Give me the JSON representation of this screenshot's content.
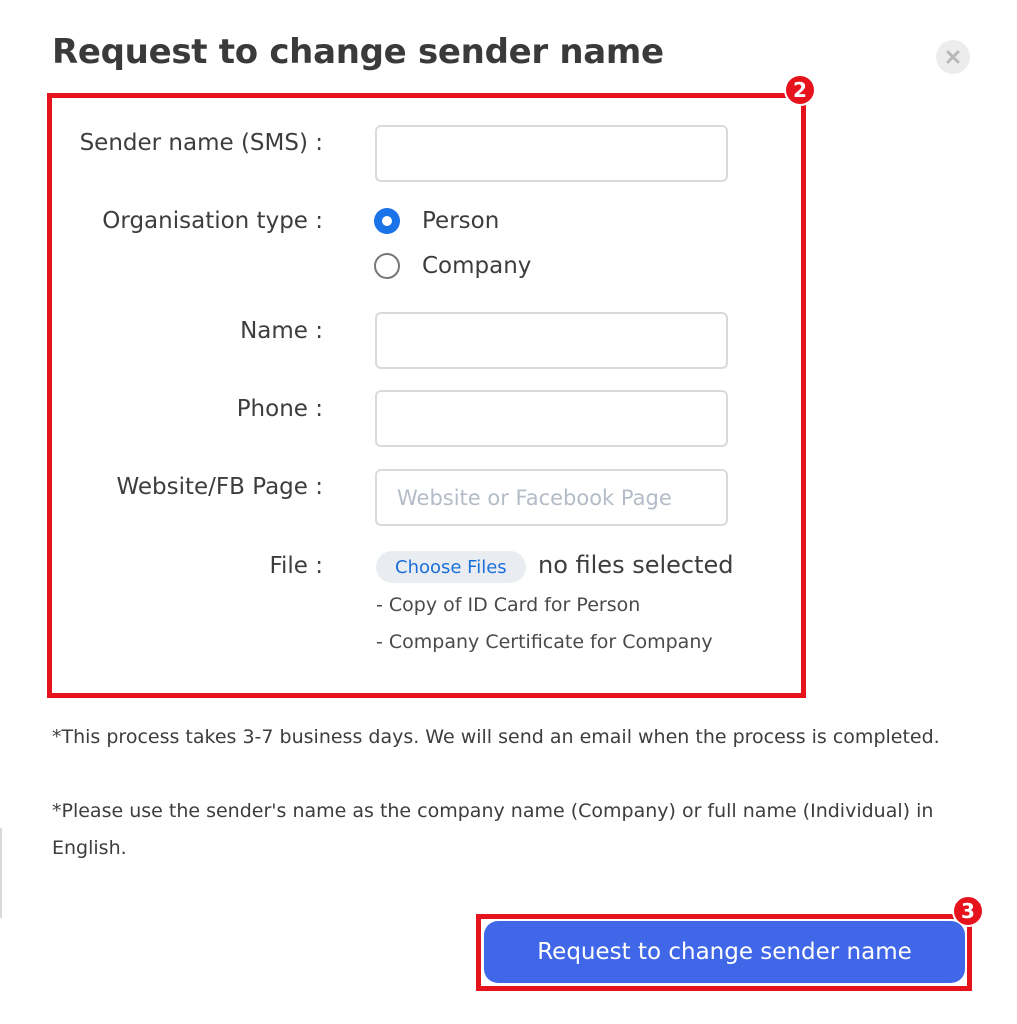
{
  "dialog": {
    "title": "Request to change sender name"
  },
  "annotations": {
    "form_step": "2",
    "submit_step": "3"
  },
  "form": {
    "sender_name": {
      "label": "Sender name (SMS) :",
      "value": "",
      "placeholder": ""
    },
    "organisation_type": {
      "label": "Organisation type :",
      "options": [
        {
          "label": "Person",
          "selected": true
        },
        {
          "label": "Company",
          "selected": false
        }
      ]
    },
    "name": {
      "label": "Name :",
      "value": "",
      "placeholder": ""
    },
    "phone": {
      "label": "Phone :",
      "value": "",
      "placeholder": ""
    },
    "website": {
      "label": "Website/FB Page :",
      "value": "",
      "placeholder": "Website or Facebook Page"
    },
    "file": {
      "label": "File :",
      "button_label": "Choose Files",
      "status": "no files selected",
      "hints": [
        "- Copy of ID Card for Person",
        "- Company Certificate for Company"
      ]
    }
  },
  "notes": [
    "*This process takes 3-7 business days. We will send an email when the process is completed.",
    "*Please use the sender's name as the company name (Company) or full name (Individual) in English."
  ],
  "submit_label": "Request to change sender name",
  "colors": {
    "accent": "#1a73e8",
    "button": "#3f67e7",
    "annotation_red": "#e6121c"
  }
}
